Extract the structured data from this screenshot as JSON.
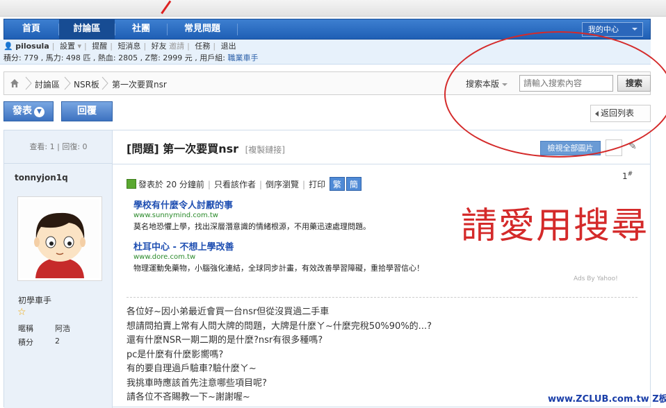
{
  "nav": {
    "items": [
      "首頁",
      "討論區",
      "社團",
      "常見問題"
    ],
    "active_index": 1,
    "my_center": "我的中心"
  },
  "userbar": {
    "username": "pilosula",
    "links": [
      "設置",
      "提醒",
      "短消息",
      "好友",
      "邀請",
      "任務",
      "退出"
    ],
    "stats_text": "積分: 779 , 馬力: 498 匹 , 熱血: 2805 , Z幣: 2999 元 , 用戶組:",
    "group": "職業車手"
  },
  "breadcrumb": {
    "items": [
      "討論區",
      "NSR板",
      "第一次要買nsr"
    ]
  },
  "search": {
    "scope_label": "搜索本版",
    "placeholder": "請輸入搜索內容",
    "button": "搜索"
  },
  "actions": {
    "post": "發表",
    "reply": "回覆",
    "back": "返回列表"
  },
  "thread": {
    "stats": "查看: 1 | 回復: 0",
    "title": "[問題] 第一次要買nsr",
    "copy_link": "[複製鏈接]",
    "view_all_images": "檢視全部圖片",
    "tool_glyph": "✎"
  },
  "author": {
    "name": "tonnyjon1q",
    "rank": "初學車手",
    "nickname_label": "暱稱",
    "nickname_value": "阿浩",
    "points_label": "積分",
    "points_value": "2"
  },
  "post_info": {
    "posted": "發表於 20 分鐘前",
    "only_author": "只看該作者",
    "reverse": "倒序瀏覽",
    "print": "打印",
    "trad": "繁",
    "simp": "簡",
    "floor": "1",
    "floor_mark": "#"
  },
  "ads": [
    {
      "title": "學校有什麼令人討厭的事",
      "url": "www.sunnymind.com.tw",
      "desc": "莫名地恐懼上學，找出深層潛意識的情緒根源，不用藥迅速處理問題。"
    },
    {
      "title": "杜耳中心 - 不想上學改善",
      "url": "www.dore.com.tw",
      "desc": "物理運動免藥物，小腦強化連結，全球同步計畫，有效改善學習障礙，重拾學習信心！"
    }
  ],
  "ads_by": "Ads By Yahoo!",
  "body_lines": [
    "各位好~因小弟最近會買一台nsr但從沒買過二手車",
    "想請問拍賣上常有人問大牌的問題，大牌是什麼ㄚ~什麼完稅50%90%的...?",
    "還有什麼NSR一期二期的是什麼?nsr有很多種嗎?",
    "pc是什麼有什麼影嚮嗎?",
    "有的要自理過戶驗車?驗什麼ㄚ~",
    "我挑車時應該首先注意哪些項目呢?",
    "請各位不吝賜教一下~謝謝喔~"
  ],
  "annotation": {
    "text": "請愛用搜尋",
    "color": "#d42a2a"
  },
  "watermark": "www.ZCLUB.com.tw Z板"
}
